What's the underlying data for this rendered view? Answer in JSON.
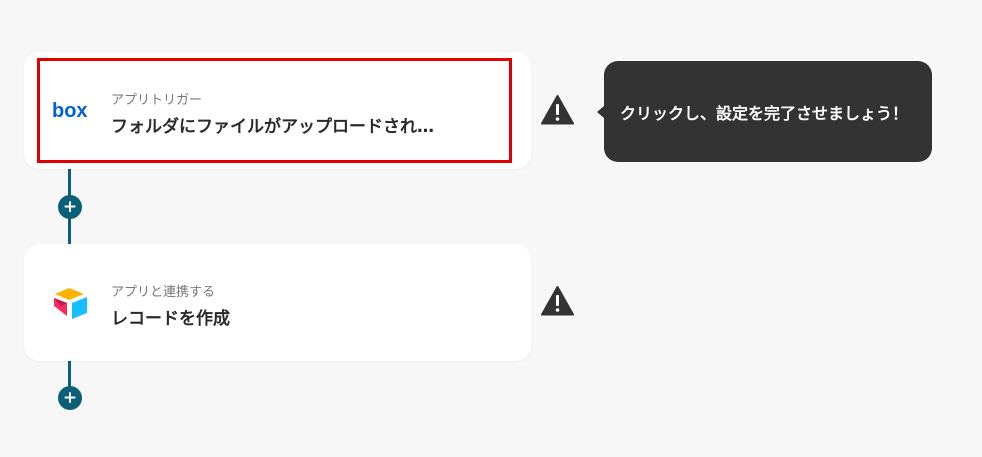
{
  "steps": [
    {
      "app": "box",
      "subtitle": "アプリトリガー",
      "title": "フォルダにファイルがアップロードされ…",
      "icon": "box-logo-icon",
      "warning": true,
      "highlighted": true
    },
    {
      "app": "airtable",
      "subtitle": "アプリと連携する",
      "title": "レコードを作成",
      "icon": "airtable-logo-icon",
      "warning": true,
      "highlighted": false
    }
  ],
  "tooltip": {
    "text": "クリックし、設定を完了させましょう！"
  },
  "add_button": {
    "label": "+"
  },
  "colors": {
    "connector": "#0b5f77",
    "highlight_border": "#e00000",
    "tooltip_bg": "#333333",
    "background": "#f7f7f7",
    "box_brand": "#0061d5"
  }
}
